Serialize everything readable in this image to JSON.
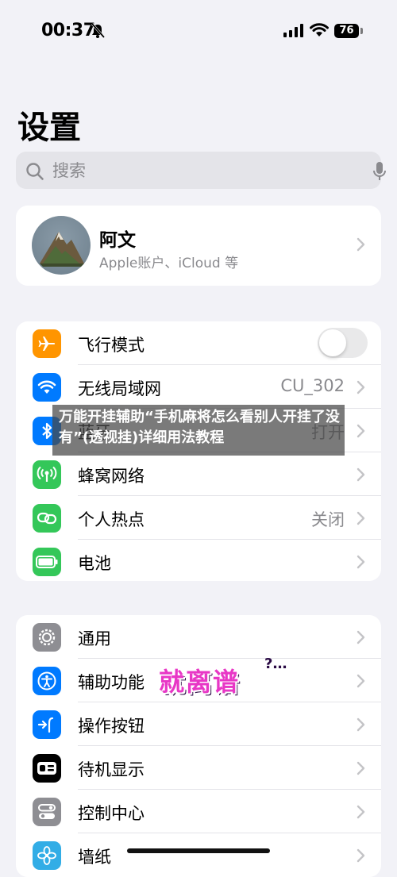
{
  "status_bar": {
    "time": "00:37",
    "battery": "76"
  },
  "title": "设置",
  "search": {
    "placeholder": "搜索"
  },
  "profile": {
    "name": "阿文",
    "subtitle": "Apple账户、iCloud 等"
  },
  "group1": {
    "rows": [
      {
        "label": "飞行模式",
        "value": "",
        "toggle": false
      },
      {
        "label": "无线局域网",
        "value": "CU_302"
      },
      {
        "label": "蓝牙",
        "value": "打开"
      },
      {
        "label": "蜂窝网络",
        "value": ""
      },
      {
        "label": "个人热点",
        "value": "关闭"
      },
      {
        "label": "电池",
        "value": ""
      }
    ]
  },
  "group2": {
    "rows": [
      {
        "label": "通用"
      },
      {
        "label": "辅助功能"
      },
      {
        "label": "操作按钮"
      },
      {
        "label": "待机显示"
      },
      {
        "label": "控制中心"
      },
      {
        "label": "墙纸"
      }
    ]
  },
  "overlay_text": "万能开挂辅助“手机麻将怎么看别人开挂了没有”(透视挂)详细用法教程",
  "sticker_text": "就离谱",
  "sticker_suffix": "?…",
  "colors": {
    "airplane": "#ff9500",
    "wifi": "#007aff",
    "bluetooth": "#007aff",
    "cellular": "#34c759",
    "hotspot": "#34c759",
    "battery": "#34c759",
    "general": "#8e8e93",
    "accessibility": "#007aff",
    "action": "#007aff",
    "standby": "#000000",
    "control": "#8e8e93",
    "wallpaper": "#32ade6"
  }
}
